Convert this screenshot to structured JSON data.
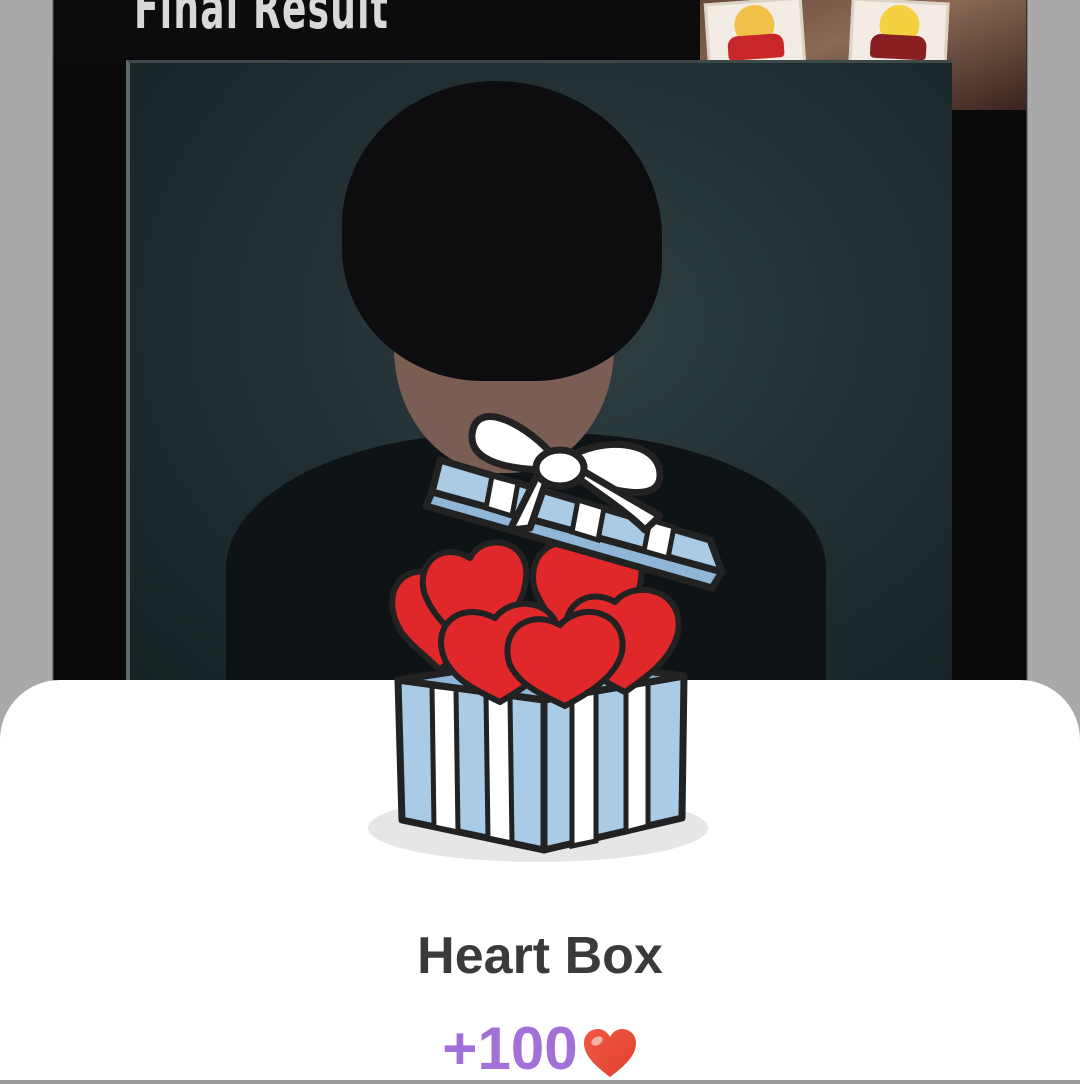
{
  "background": {
    "header_title": "Final Result"
  },
  "reward": {
    "item_name": "Heart Box",
    "amount": "+100",
    "currency_icon": "heart-icon",
    "colors": {
      "amount": "#a370d8",
      "heart": "#e5483a",
      "box_blue": "#a9cbe6",
      "heart_red": "#e0282a"
    }
  }
}
